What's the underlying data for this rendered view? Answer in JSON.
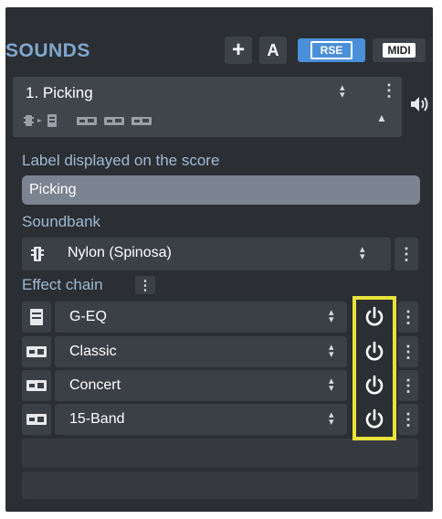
{
  "header": {
    "title": "SOUNDS",
    "add_label": "+",
    "a_label": "A",
    "rse_label": "RSE",
    "midi_label": "MIDI"
  },
  "track": {
    "name": "1. Picking"
  },
  "label_section": {
    "label": "Label displayed on the score",
    "value": "Picking"
  },
  "soundbank": {
    "label": "Soundbank",
    "value": "Nylon (Spinosa)"
  },
  "effect_chain": {
    "label": "Effect chain",
    "effects": [
      {
        "name": "G-EQ",
        "icon": "eq-icon"
      },
      {
        "name": "Classic",
        "icon": "amp-icon"
      },
      {
        "name": "Concert",
        "icon": "amp-icon"
      },
      {
        "name": "15-Band",
        "icon": "amp-icon"
      }
    ]
  },
  "colors": {
    "panel": "#2b2e33",
    "title": "#7fa7cf",
    "rse": "#4a8fd8",
    "highlight": "#e9e23a",
    "label": "#9fb9d4"
  }
}
